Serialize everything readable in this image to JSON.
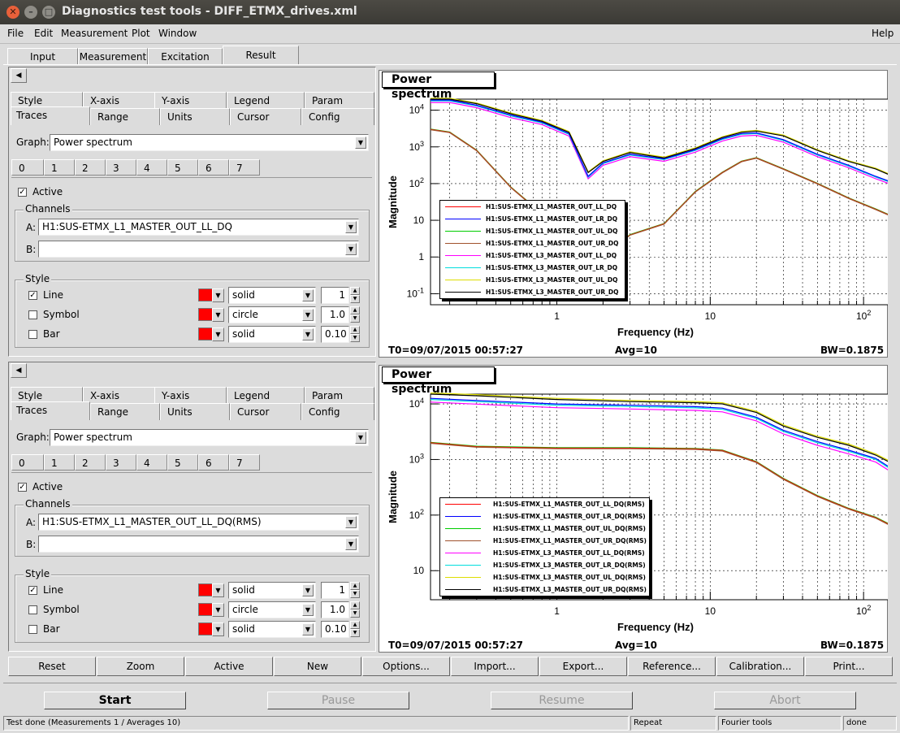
{
  "window": {
    "title": "Diagnostics test tools - DIFF_ETMX_drives.xml"
  },
  "menu": {
    "file": "File",
    "edit": "Edit",
    "measurement": "Measurement",
    "plot": "Plot",
    "window": "Window",
    "help": "Help"
  },
  "main_tabs": [
    "Input",
    "Measurement",
    "Excitation",
    "Result"
  ],
  "panels": [
    {
      "tabs_row1": [
        "Style",
        "X-axis",
        "Y-axis",
        "Legend",
        "Param"
      ],
      "tabs_row2": [
        "Traces",
        "Range",
        "Units",
        "Cursor",
        "Config"
      ],
      "graph_label": "Graph:",
      "graph_value": "Power spectrum",
      "trace_tabs": [
        "0",
        "1",
        "2",
        "3",
        "4",
        "5",
        "6",
        "7"
      ],
      "active_label": "Active",
      "channels_label": "Channels",
      "channel_a_label": "A:",
      "channel_a": "H1:SUS-ETMX_L1_MASTER_OUT_LL_DQ",
      "channel_b_label": "B:",
      "channel_b": "",
      "style_label": "Style",
      "line_label": "Line",
      "line_style": "solid",
      "line_width": "1",
      "symbol_label": "Symbol",
      "symbol_style": "circle",
      "symbol_size": "1.0",
      "bar_label": "Bar",
      "bar_style": "solid",
      "bar_width": "0.10"
    },
    {
      "tabs_row1": [
        "Style",
        "X-axis",
        "Y-axis",
        "Legend",
        "Param"
      ],
      "tabs_row2": [
        "Traces",
        "Range",
        "Units",
        "Cursor",
        "Config"
      ],
      "graph_label": "Graph:",
      "graph_value": "Power spectrum",
      "trace_tabs": [
        "0",
        "1",
        "2",
        "3",
        "4",
        "5",
        "6",
        "7"
      ],
      "active_label": "Active",
      "channels_label": "Channels",
      "channel_a_label": "A:",
      "channel_a": "H1:SUS-ETMX_L1_MASTER_OUT_LL_DQ(RMS)",
      "channel_b_label": "B:",
      "channel_b": "",
      "style_label": "Style",
      "line_label": "Line",
      "line_style": "solid",
      "line_width": "1",
      "symbol_label": "Symbol",
      "symbol_style": "circle",
      "symbol_size": "1.0",
      "bar_label": "Bar",
      "bar_style": "solid",
      "bar_width": "0.10"
    }
  ],
  "colors": {
    "trace_color": "#ff0000",
    "accent": "#f07746"
  },
  "chart_data": [
    {
      "type": "line",
      "title": "Power spectrum",
      "xlabel": "Frequency (Hz)",
      "ylabel": "Magnitude",
      "x_scale": "log",
      "y_scale": "log",
      "xlim": [
        0.15,
        210
      ],
      "ylim": [
        0.05,
        20000
      ],
      "x_ticks": [
        "1",
        "10",
        "10^2"
      ],
      "y_ticks": [
        "10^-1",
        "1",
        "10",
        "10^2",
        "10^3",
        "10^4"
      ],
      "grid": true,
      "legend_position": "bottom-left",
      "footer": {
        "t0": "T0=09/07/2015 00:57:27",
        "avg": "Avg=10",
        "bw": "BW=0.1875"
      },
      "series": [
        {
          "name": "H1:SUS-ETMX_L1_MASTER_OUT_LL_DQ",
          "color": "#ff0000"
        },
        {
          "name": "H1:SUS-ETMX_L1_MASTER_OUT_LR_DQ",
          "color": "#0000ff"
        },
        {
          "name": "H1:SUS-ETMX_L1_MASTER_OUT_UL_DQ",
          "color": "#00cc00"
        },
        {
          "name": "H1:SUS-ETMX_L1_MASTER_OUT_UR_DQ",
          "color": "#a0522d"
        },
        {
          "name": "H1:SUS-ETMX_L3_MASTER_OUT_LL_DQ",
          "color": "#ff00ff"
        },
        {
          "name": "H1:SUS-ETMX_L3_MASTER_OUT_LR_DQ",
          "color": "#00dddd"
        },
        {
          "name": "H1:SUS-ETMX_L3_MASTER_OUT_UL_DQ",
          "color": "#dddd00"
        },
        {
          "name": "H1:SUS-ETMX_L3_MASTER_OUT_UR_DQ",
          "color": "#000000"
        }
      ],
      "curves": {
        "x": [
          0.15,
          0.2,
          0.3,
          0.5,
          0.8,
          1.2,
          1.6,
          2,
          3,
          5,
          8,
          12,
          16,
          20,
          30,
          50,
          80,
          120,
          200
        ],
        "l3_upper": [
          20000,
          20000,
          15000,
          8000,
          5000,
          2500,
          200,
          400,
          700,
          500,
          900,
          1800,
          2500,
          2700,
          2000,
          800,
          400,
          250,
          100
        ],
        "l3_lower": [
          18000,
          18000,
          13000,
          7000,
          4500,
          2200,
          150,
          350,
          600,
          450,
          800,
          1600,
          2200,
          2300,
          1500,
          600,
          300,
          150,
          70
        ],
        "l1": [
          3000,
          2500,
          800,
          80,
          15,
          2,
          0.5,
          1,
          4,
          8,
          60,
          200,
          400,
          500,
          250,
          100,
          40,
          20,
          8
        ]
      }
    },
    {
      "type": "line",
      "title": "Power spectrum",
      "xlabel": "Frequency (Hz)",
      "ylabel": "Magnitude",
      "x_scale": "log",
      "y_scale": "log",
      "xlim": [
        0.15,
        210
      ],
      "ylim": [
        3,
        15000
      ],
      "x_ticks": [
        "1",
        "10",
        "10^2"
      ],
      "y_ticks": [
        "10",
        "10^2",
        "10^3",
        "10^4"
      ],
      "grid": true,
      "legend_position": "bottom-left",
      "footer": {
        "t0": "T0=09/07/2015 00:57:27",
        "avg": "Avg=10",
        "bw": "BW=0.1875"
      },
      "series": [
        {
          "name": "H1:SUS-ETMX_L1_MASTER_OUT_LL_DQ(RMS)",
          "color": "#ff0000"
        },
        {
          "name": "H1:SUS-ETMX_L1_MASTER_OUT_LR_DQ(RMS)",
          "color": "#0000ff"
        },
        {
          "name": "H1:SUS-ETMX_L1_MASTER_OUT_UL_DQ(RMS)",
          "color": "#00cc00"
        },
        {
          "name": "H1:SUS-ETMX_L1_MASTER_OUT_UR_DQ(RMS)",
          "color": "#a0522d"
        },
        {
          "name": "H1:SUS-ETMX_L3_MASTER_OUT_LL_DQ(RMS)",
          "color": "#ff00ff"
        },
        {
          "name": "H1:SUS-ETMX_L3_MASTER_OUT_LR_DQ(RMS)",
          "color": "#00dddd"
        },
        {
          "name": "H1:SUS-ETMX_L3_MASTER_OUT_UL_DQ(RMS)",
          "color": "#dddd00"
        },
        {
          "name": "H1:SUS-ETMX_L3_MASTER_OUT_UR_DQ(RMS)",
          "color": "#000000"
        }
      ],
      "curves": {
        "x": [
          0.15,
          0.3,
          1,
          3,
          8,
          12,
          20,
          30,
          50,
          80,
          120,
          160,
          190,
          200
        ],
        "l3_upper": [
          15000,
          14000,
          12000,
          11000,
          10500,
          10000,
          7000,
          4000,
          2500,
          1800,
          1200,
          800,
          300,
          30
        ],
        "l3_lower": [
          12000,
          11000,
          9500,
          9000,
          8500,
          8000,
          5500,
          3200,
          2000,
          1400,
          1000,
          600,
          200,
          20
        ],
        "l1": [
          2000,
          1700,
          1600,
          1600,
          1550,
          1450,
          900,
          450,
          220,
          130,
          90,
          60,
          25,
          5
        ]
      }
    }
  ],
  "bottom_buttons": [
    "Reset",
    "Zoom",
    "Active",
    "New",
    "Options...",
    "Import...",
    "Export...",
    "Reference...",
    "Calibration...",
    "Print..."
  ],
  "action_buttons": {
    "start": "Start",
    "pause": "Pause",
    "resume": "Resume",
    "abort": "Abort"
  },
  "status": {
    "message": "Test done (Measurements 1 / Averages 10)",
    "repeat": "Repeat",
    "tool": "Fourier tools",
    "state": "done"
  }
}
